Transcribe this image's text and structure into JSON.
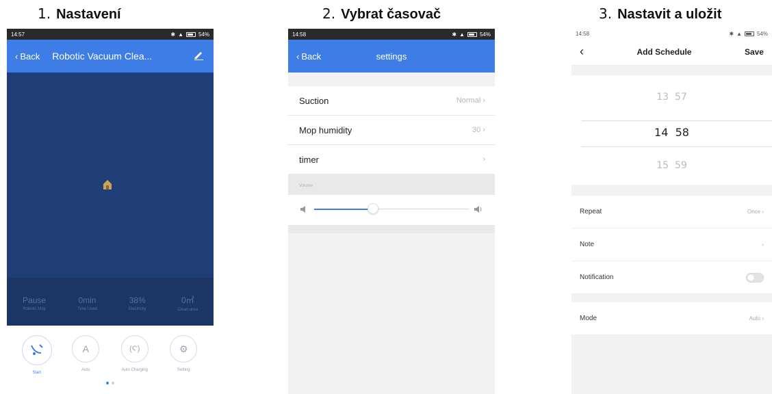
{
  "steps": [
    {
      "number": "1.",
      "title": "Nastavení"
    },
    {
      "number": "2.",
      "title": "Vybrat časovač"
    },
    {
      "number": "3.",
      "title": "Nastavit a uložit"
    }
  ],
  "screen1": {
    "status_time": "14:57",
    "status_battery": "54%",
    "back_label": "Back",
    "title": "Robotic Vacuum Clea...",
    "stats": [
      {
        "value": "Pause",
        "label": "Robotic Mop"
      },
      {
        "value": "0min",
        "label": "Time Used"
      },
      {
        "value": "38%",
        "label": "Electricity"
      },
      {
        "value": "0㎡",
        "label": "Clean area"
      }
    ],
    "controls": [
      {
        "icon": "vacuum-icon",
        "glyph": "ఆ",
        "label": "Start"
      },
      {
        "icon": "auto-icon",
        "glyph": "A",
        "label": "Auto"
      },
      {
        "icon": "auto-charging-icon",
        "glyph": "(Ϛ)",
        "label": "Auto Charging"
      },
      {
        "icon": "gear-icon",
        "glyph": "⚙",
        "label": "Setting"
      }
    ],
    "accent": "#3d7de5",
    "map_color": "#1f3d76"
  },
  "screen2": {
    "status_time": "14:58",
    "status_battery": "54%",
    "back_label": "Back",
    "title": "settings",
    "rows": [
      {
        "label": "Suction",
        "value": "Normal"
      },
      {
        "label": "Mop humidity",
        "value": "30"
      },
      {
        "label": "timer",
        "value": ""
      }
    ],
    "volume_label": "Volume",
    "volume_level": 0.38
  },
  "screen3": {
    "status_time": "14:58",
    "status_battery": "54%",
    "title": "Add Schedule",
    "save_label": "Save",
    "picker": {
      "prev": {
        "hour": "13",
        "minute": "57"
      },
      "selected": {
        "hour": "14",
        "minute": "58"
      },
      "next": {
        "hour": "15",
        "minute": "59"
      }
    },
    "rows_group1": [
      {
        "label": "Repeat",
        "value": "Once"
      },
      {
        "label": "Note",
        "value": ""
      },
      {
        "label": "Notification",
        "value": ""
      }
    ],
    "rows_group2": [
      {
        "label": "Mode",
        "value": "Auto"
      }
    ]
  }
}
